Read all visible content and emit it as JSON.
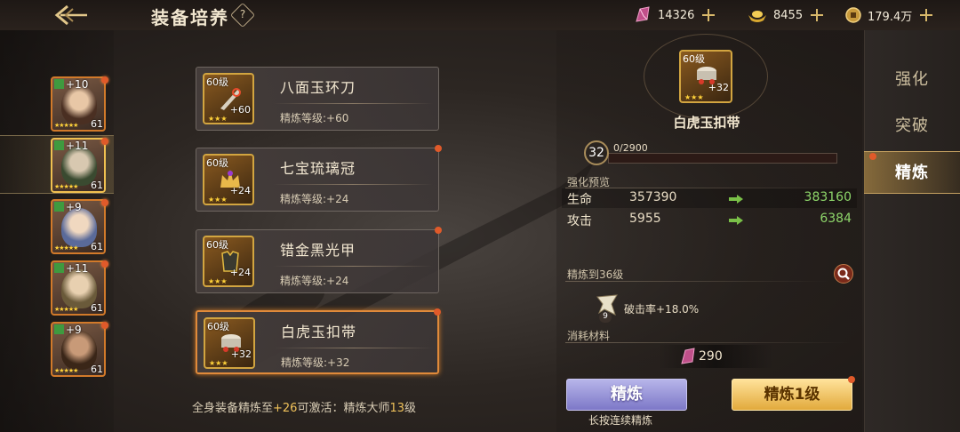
{
  "header": {
    "title": "装备培养",
    "help_icon": "?",
    "resources": [
      {
        "icon": "crystal-icon",
        "value": "14326"
      },
      {
        "icon": "ingot-icon",
        "value": "8455"
      },
      {
        "icon": "coin-icon",
        "value": "179.4万"
      }
    ]
  },
  "heroes": [
    {
      "plus": "+10",
      "level": "61",
      "stars": "★★★★★",
      "selected": false,
      "dot": true
    },
    {
      "plus": "+11",
      "level": "61",
      "stars": "★★★★★",
      "selected": true,
      "dot": true
    },
    {
      "plus": "+9",
      "level": "61",
      "stars": "★★★★★",
      "selected": false,
      "dot": true
    },
    {
      "plus": "+11",
      "level": "61",
      "stars": "★★★★★",
      "selected": false,
      "dot": true
    },
    {
      "plus": "+9",
      "level": "61",
      "stars": "★★★★★",
      "selected": false,
      "dot": true
    }
  ],
  "equipment": [
    {
      "level_tag": "60级",
      "bonus": "+60",
      "stars": "★★★",
      "name": "八面玉环刀",
      "refine": "精炼等级:+60"
    },
    {
      "level_tag": "60级",
      "bonus": "+24",
      "stars": "★★★",
      "name": "七宝琉璃冠",
      "refine": "精炼等级:+24"
    },
    {
      "level_tag": "60级",
      "bonus": "+24",
      "stars": "★★★",
      "name": "错金黑光甲",
      "refine": "精炼等级:+24"
    },
    {
      "level_tag": "60级",
      "bonus": "+32",
      "stars": "★★★",
      "name": "白虎玉扣带",
      "refine": "精炼等级:+32"
    }
  ],
  "master_line": {
    "prefix": "全身装备精炼至",
    "value": "+26",
    "middle": "可激活：精炼大师",
    "level": "13",
    "suffix": "级"
  },
  "detail": {
    "item": {
      "level_tag": "60级",
      "bonus": "+32",
      "stars": "★★★",
      "name": "白虎玉扣带"
    },
    "level": "32",
    "exp_text": "0/2900",
    "exp_progress": 0,
    "preview_label": "强化预览",
    "stats": [
      {
        "name": "生命",
        "current": "357390",
        "next": "383160"
      },
      {
        "name": "攻击",
        "current": "5955",
        "next": "6384"
      }
    ],
    "unlock_label": "精炼到36级",
    "crit_badge": "9",
    "crit_text": "破击率+18.0%",
    "material_label": "消耗材料",
    "material_count": "290",
    "refine_button": "精炼",
    "hold_hint": "长按连续精炼",
    "refine_one_button": "精炼1级"
  },
  "tabs": [
    {
      "label": "强化",
      "active": false
    },
    {
      "label": "突破",
      "active": false
    },
    {
      "label": "精炼",
      "active": true
    }
  ],
  "colors": {
    "accent_orange": "#e08a3a",
    "stat_up_green": "#8ed66a",
    "highlight_gold": "#f0c25a"
  }
}
